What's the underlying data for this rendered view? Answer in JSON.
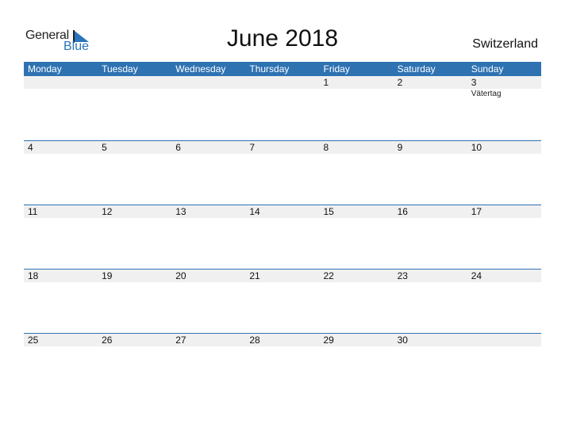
{
  "logo": {
    "general": "General",
    "blue": "Blue"
  },
  "title": "June 2018",
  "country": "Switzerland",
  "weekdays": [
    "Monday",
    "Tuesday",
    "Wednesday",
    "Thursday",
    "Friday",
    "Saturday",
    "Sunday"
  ],
  "weeks": [
    {
      "dates": [
        "",
        "",
        "",
        "",
        "1",
        "2",
        "3"
      ],
      "events": [
        "",
        "",
        "",
        "",
        "",
        "",
        "Vätertag"
      ]
    },
    {
      "dates": [
        "4",
        "5",
        "6",
        "7",
        "8",
        "9",
        "10"
      ],
      "events": [
        "",
        "",
        "",
        "",
        "",
        "",
        ""
      ]
    },
    {
      "dates": [
        "11",
        "12",
        "13",
        "14",
        "15",
        "16",
        "17"
      ],
      "events": [
        "",
        "",
        "",
        "",
        "",
        "",
        ""
      ]
    },
    {
      "dates": [
        "18",
        "19",
        "20",
        "21",
        "22",
        "23",
        "24"
      ],
      "events": [
        "",
        "",
        "",
        "",
        "",
        "",
        ""
      ]
    },
    {
      "dates": [
        "25",
        "26",
        "27",
        "28",
        "29",
        "30",
        ""
      ],
      "events": [
        "",
        "",
        "",
        "",
        "",
        "",
        ""
      ]
    }
  ],
  "colors": {
    "accent": "#2e72b2",
    "date_row": "#f0f0f0"
  }
}
